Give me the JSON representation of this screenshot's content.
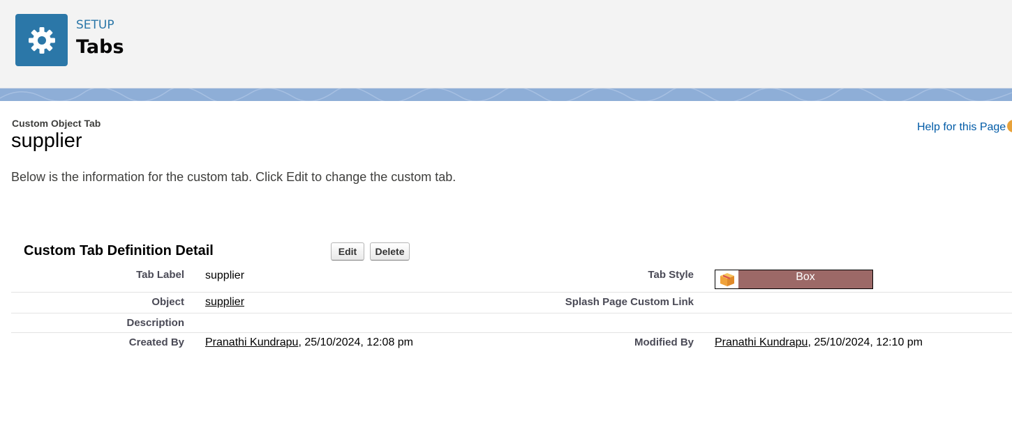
{
  "header": {
    "section_label": "SETUP",
    "title": "Tabs"
  },
  "page": {
    "type_label": "Custom Object Tab",
    "name": "supplier",
    "help_link": "Help for this Page",
    "intro": "Below is the information for the custom tab. Click Edit to change the custom tab."
  },
  "detail": {
    "title": "Custom Tab Definition Detail",
    "edit_label": "Edit",
    "delete_label": "Delete",
    "fields": {
      "tab_label": {
        "label": "Tab Label",
        "value": "supplier"
      },
      "tab_style": {
        "label": "Tab Style",
        "value": "Box",
        "icon": "box-icon",
        "color": "#9c6967"
      },
      "object": {
        "label": "Object",
        "value": "supplier"
      },
      "splash_page": {
        "label": "Splash Page Custom Link",
        "value": ""
      },
      "description": {
        "label": "Description",
        "value": ""
      },
      "created_by": {
        "label": "Created By",
        "user": "Pranathi Kundrapu",
        "timestamp": ", 25/10/2024, 12:08 pm"
      },
      "modified_by": {
        "label": "Modified By",
        "user": "Pranathi Kundrapu",
        "timestamp": ", 25/10/2024, 12:10 pm"
      }
    }
  },
  "colors": {
    "header_bg": "#f3f3f3",
    "setup_icon_bg": "#2b77a8",
    "band": "#8eaed7",
    "link": "#015ba7"
  }
}
